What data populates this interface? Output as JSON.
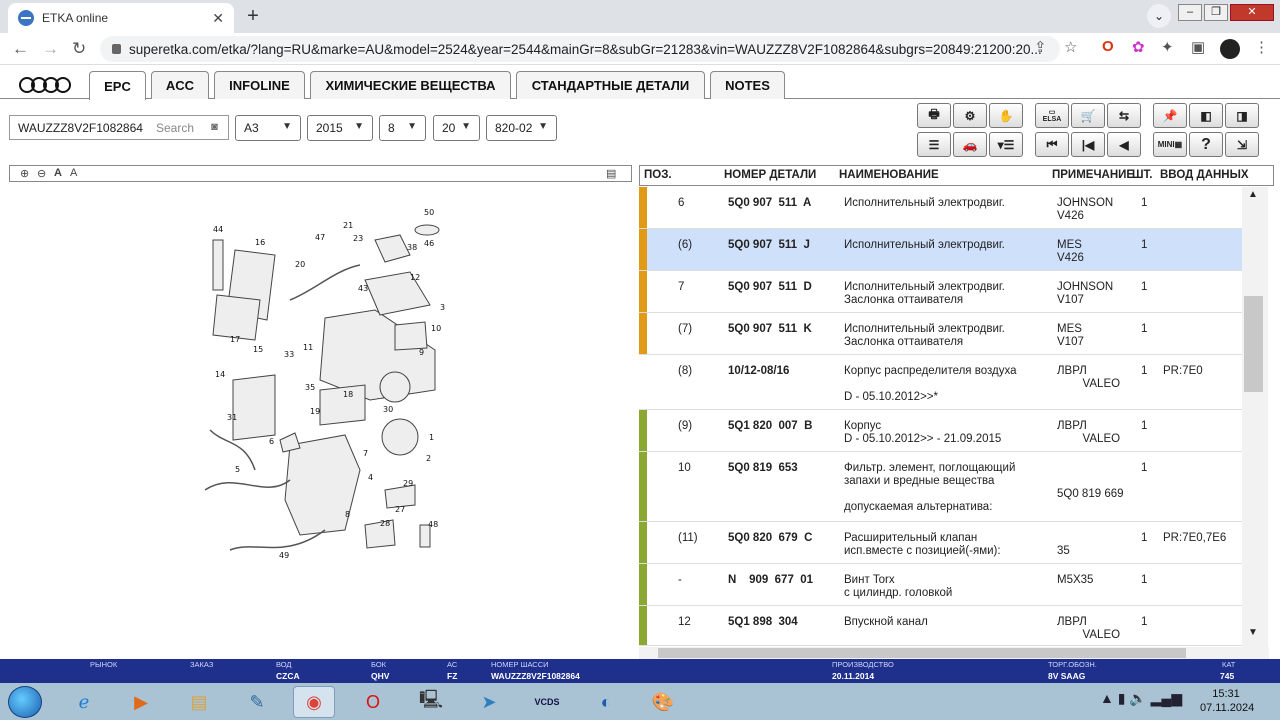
{
  "browser": {
    "tab_title": "ETKA online",
    "url": "superetka.com/etka/?lang=RU&marke=AU&model=2524&year=2544&mainGr=8&subGr=21283&vin=WAUZZZ8V2F1082864&subgrs=20849:21200:20..."
  },
  "tabs": [
    "EPC",
    "ACC",
    "INFOLINE",
    "ХИМИЧЕСКИЕ ВЕЩЕСТВА",
    "СТАНДАРТНЫЕ ДЕТАЛИ",
    "NOTES"
  ],
  "search": {
    "vin": "WAUZZZ8V2F1082864",
    "button": "Search"
  },
  "selects": {
    "model": "A3",
    "year": "2015",
    "main_group": "8",
    "sub_group": "20",
    "illustration": "820-02"
  },
  "toolbar": {
    "mini_label": "MINI",
    "elsa_label": "ELSA",
    "help": "?"
  },
  "table": {
    "headers": {
      "pos": "ПОЗ.",
      "part": "НОМЕР ДЕТАЛИ",
      "name": "НАИМЕНОВАНИЕ",
      "note": "ПРИМЕЧАНИЕ",
      "qty": "ШТ.",
      "data": "ВВОД ДАННЫХ"
    },
    "rows": [
      {
        "pos": "6",
        "part": "5Q0 907  511  A",
        "name": "Исполнительный электродвиг.",
        "note": "JOHNSON\nV426",
        "qty": "1",
        "data": ""
      },
      {
        "pos": "(6)",
        "part": "5Q0 907  511  J",
        "name": "Исполнительный электродвиг.",
        "note": "MES\nV426",
        "qty": "1",
        "data": ""
      },
      {
        "pos": "7",
        "part": "5Q0 907  511  D",
        "name": "Исполнительный электродвиг.\nЗаслонка оттаивателя",
        "note": "JOHNSON\nV107",
        "qty": "1",
        "data": ""
      },
      {
        "pos": "(7)",
        "part": "5Q0 907  511  K",
        "name": "Исполнительный электродвиг.\nЗаслонка оттаивателя",
        "note": "MES\nV107",
        "qty": "1",
        "data": ""
      },
      {
        "pos": "(8)",
        "part": "10/12-08/16",
        "name": "Корпус распределителя воздуха\n\nD - 05.10.2012>>*",
        "note": "ЛВРЛ\n        VALEO",
        "qty": "1",
        "data": "PR:7E0"
      },
      {
        "pos": "(9)",
        "part": "5Q1 820  007  B",
        "name": "Корпус\nD - 05.10.2012>> - 21.09.2015",
        "note": "ЛВРЛ\n        VALEO",
        "qty": "1",
        "data": ""
      },
      {
        "pos": "10",
        "part": "5Q0 819  653",
        "name": "Фильтр. элемент, поглощающий\nзапахи и вредные вещества\n\nдопускаемая альтернатива:",
        "note": "\n\n5Q0 819 669",
        "qty": "1",
        "data": ""
      },
      {
        "pos": "(11)",
        "part": "5Q0 820  679  C",
        "name": "Расширительный клапан\nисп.вместе с позицией(-ями):",
        "note": "\n35",
        "qty": "1",
        "data": "PR:7E0,7E6"
      },
      {
        "pos": "-",
        "part": "N    909  677  01",
        "name": "Винт Torx\nс цилиндр. головкой",
        "note": "M5X35",
        "qty": "1",
        "data": ""
      },
      {
        "pos": "12",
        "part": "5Q1 898  304",
        "name": "Впускной канал",
        "note": "ЛВРЛ\n        VALEO",
        "qty": "1",
        "data": ""
      }
    ]
  },
  "diagram_labels": [
    "44",
    "16",
    "47",
    "21",
    "23",
    "38",
    "50",
    "46",
    "20",
    "12",
    "43",
    "3",
    "17",
    "10",
    "15",
    "33",
    "11",
    "9",
    "14",
    "35",
    "19",
    "18",
    "30",
    "31",
    "6",
    "1",
    "2",
    "7",
    "5",
    "4",
    "29",
    "27",
    "8",
    "28",
    "48",
    "49"
  ],
  "status": {
    "market_l": "РЫНОК",
    "order_l": "ЗАКАЗ",
    "engine_l": "ВОД",
    "engine": "CZCA",
    "gearbox_l": "БОК",
    "gearbox": "QHV",
    "ac_l": "АС",
    "ac": "FZ",
    "chassis_l": "НОМЕР ШАССИ",
    "chassis": "WAUZZZ8V2F1082864",
    "prod_l": "ПРОИЗВОДСТВО",
    "prod": "20.11.2014",
    "trade_l": "ТОРГ.ОБОЗН.",
    "trade": "8V SAAG",
    "cat_l": "КАТ",
    "cat": "745"
  },
  "clock": {
    "time": "15:31",
    "date": "07.11.2024"
  },
  "colors": {
    "orange_bar": "#e09a15",
    "green_bar": "#8aa832",
    "selected_row": "#cfe0fb",
    "status_bar": "#1e2f8c"
  }
}
